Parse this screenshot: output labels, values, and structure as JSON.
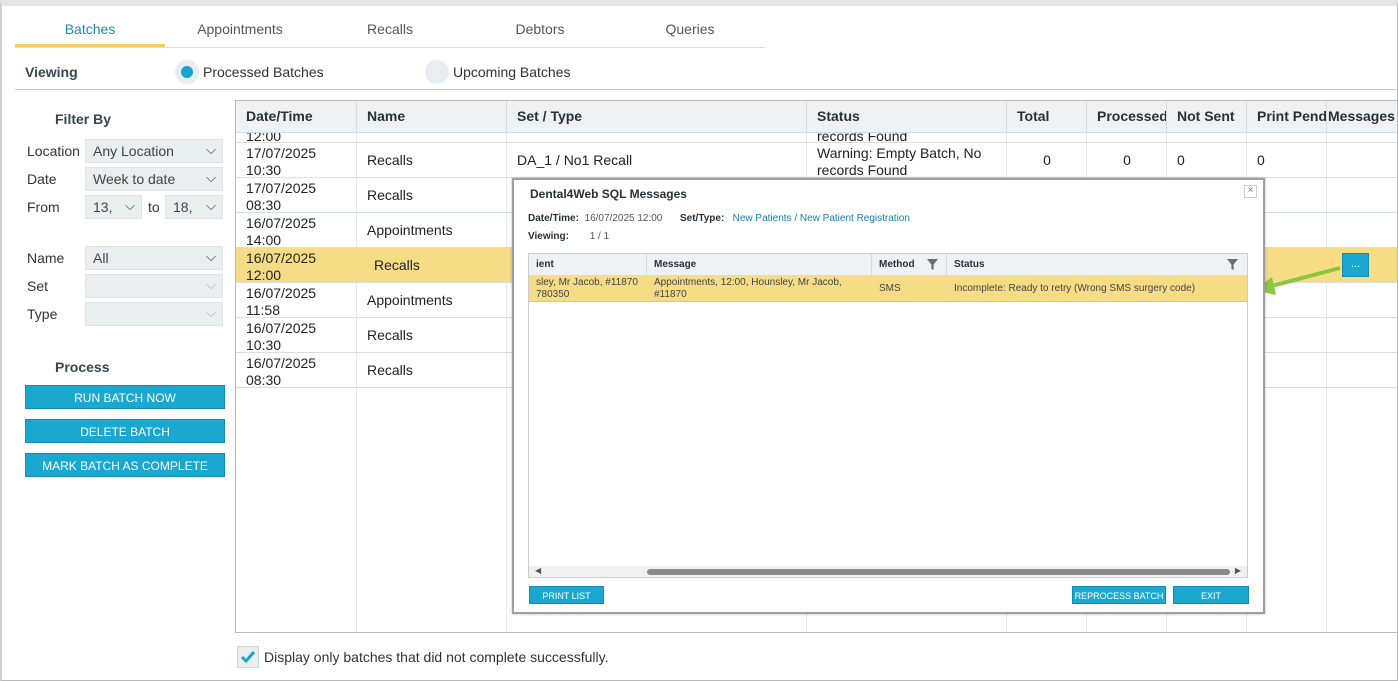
{
  "tabs": [
    {
      "label": "Batches",
      "active": true
    },
    {
      "label": "Appointments"
    },
    {
      "label": "Recalls"
    },
    {
      "label": "Debtors"
    },
    {
      "label": "Queries"
    }
  ],
  "viewing": {
    "label": "Viewing",
    "options": [
      {
        "label": "Processed Batches",
        "selected": true
      },
      {
        "label": "Upcoming Batches",
        "selected": false
      }
    ]
  },
  "filter": {
    "title": "Filter By",
    "location_label": "Location",
    "location_value": "Any Location",
    "date_label": "Date",
    "date_value": "Week to date",
    "from_label": "From",
    "from_value": "13,",
    "to_label": "to",
    "to_value": "18,",
    "name_label": "Name",
    "name_value": "All",
    "set_label": "Set",
    "set_value": "",
    "type_label": "Type",
    "type_value": ""
  },
  "process": {
    "title": "Process",
    "run_label": "RUN BATCH NOW",
    "delete_label": "DELETE BATCH",
    "complete_label": "MARK BATCH AS COMPLETE"
  },
  "grid": {
    "columns": [
      "Date/Time",
      "Name",
      "Set / Type",
      "Status",
      "Total",
      "Processed",
      "Not Sent",
      "Print Pending",
      "Messages"
    ],
    "rows": [
      {
        "date": "12:00",
        "name": "",
        "set": "",
        "status": "records Found",
        "total": "",
        "processed": "",
        "not_sent": "",
        "print": ""
      },
      {
        "date": "17/07/2025",
        "time": "10:30",
        "name": "Recalls",
        "set": "DA_1 / No1 Recall",
        "status": "Warning: Empty Batch, No",
        "status2": "records Found",
        "total": "0",
        "processed": "0",
        "not_sent": "0",
        "print": "0"
      },
      {
        "date": "17/07/2025",
        "time": "08:30",
        "name": "Recalls"
      },
      {
        "date": "16/07/2025",
        "time": "14:00",
        "name": "Appointments"
      },
      {
        "date": "16/07/2025",
        "time": "12:00",
        "name": "Recalls",
        "selected": true
      },
      {
        "date": "16/07/2025",
        "time": "11:58",
        "name": "Appointments"
      },
      {
        "date": "16/07/2025",
        "time": "10:30",
        "name": "Recalls"
      },
      {
        "date": "16/07/2025",
        "time": "08:30",
        "name": "Recalls"
      }
    ],
    "messages_button": "..."
  },
  "footer": {
    "checkbox_label": "Display only batches that did not complete successfully.",
    "checked": true
  },
  "modal": {
    "title": "Dental4Web SQL Messages",
    "close": "×",
    "datetime_label": "Date/Time:",
    "datetime_value": "16/07/2025 12:00",
    "settype_label": "Set/Type:",
    "settype_value": "New Patients / New Patient Registration",
    "viewing_label": "Viewing:",
    "viewing_value": "1 / 1",
    "columns": [
      "ient",
      "Message",
      "Method",
      "Status"
    ],
    "row": {
      "patient": "sley, Mr Jacob, #11870",
      "patient2": "780350",
      "message": "Appointments, 12:00, Hounsley, Mr Jacob,",
      "message2": "#11870",
      "method": "SMS",
      "status": "Incomplete: Ready to retry (Wrong SMS surgery code)"
    },
    "print_label": "PRINT LIST",
    "reprocess_label": "REPROCESS BATCH",
    "exit_label": "EXIT"
  },
  "colors": {
    "accent": "#1aa8d0",
    "selected_row": "#f7dc86",
    "arrow": "#8cc63f"
  }
}
